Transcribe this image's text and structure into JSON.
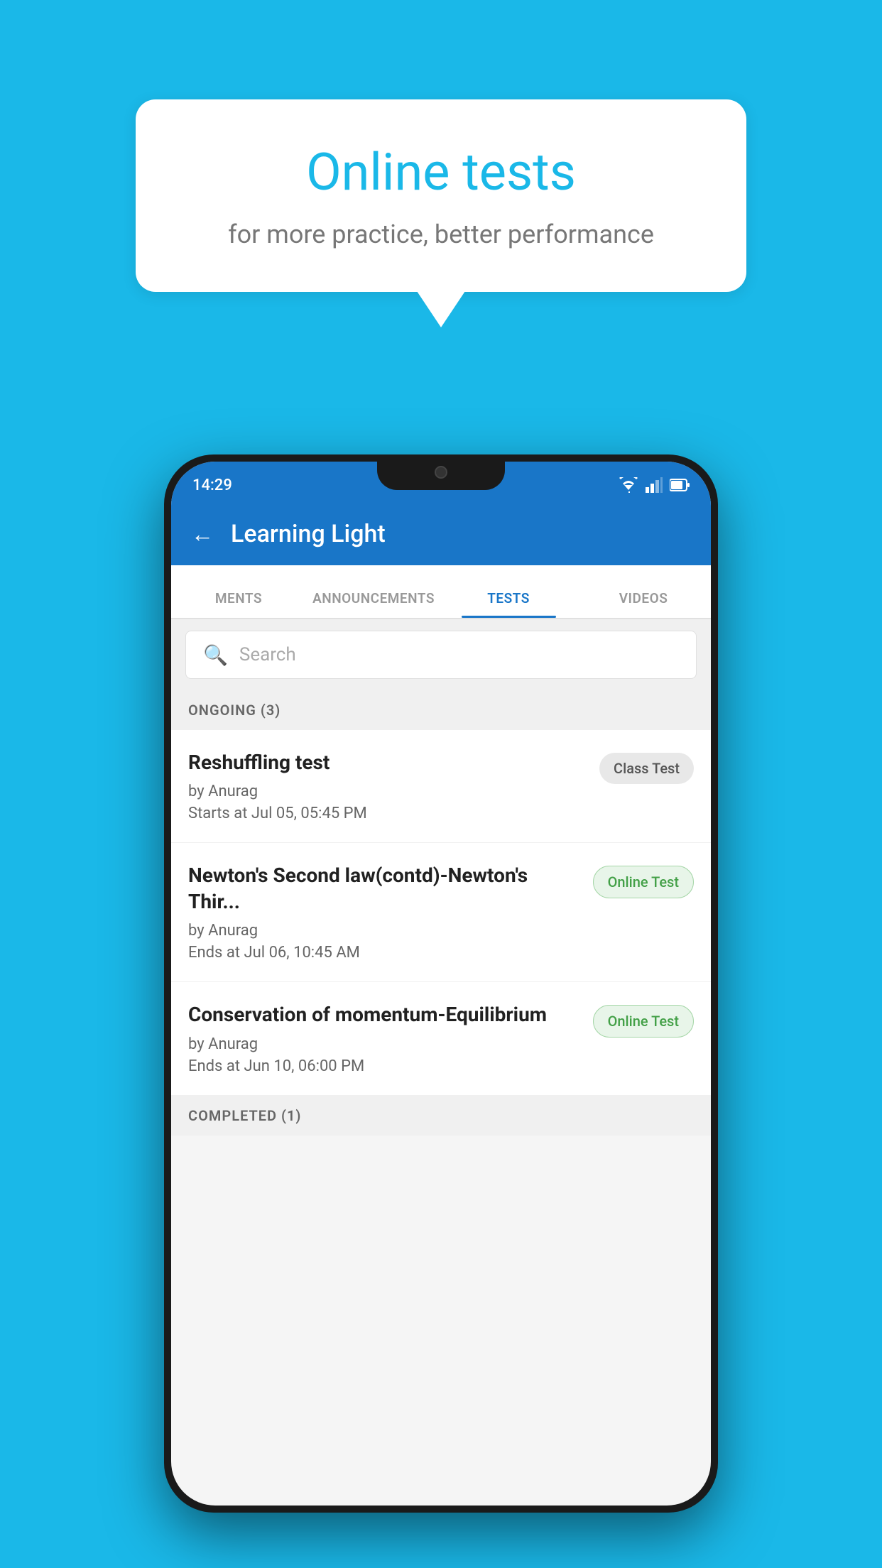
{
  "background_color": "#1ab8e8",
  "speech_bubble": {
    "title": "Online tests",
    "subtitle": "for more practice, better performance"
  },
  "phone": {
    "status_bar": {
      "time": "14:29"
    },
    "header": {
      "title": "Learning Light"
    },
    "tabs": [
      {
        "label": "MENTS",
        "active": false
      },
      {
        "label": "ANNOUNCEMENTS",
        "active": false
      },
      {
        "label": "TESTS",
        "active": true
      },
      {
        "label": "VIDEOS",
        "active": false
      }
    ],
    "search": {
      "placeholder": "Search"
    },
    "ongoing_section": {
      "label": "ONGOING (3)"
    },
    "tests": [
      {
        "title": "Reshuffling test",
        "author": "by Anurag",
        "date": "Starts at  Jul 05, 05:45 PM",
        "badge": "Class Test",
        "badge_type": "class"
      },
      {
        "title": "Newton's Second law(contd)-Newton's Thir...",
        "author": "by Anurag",
        "date": "Ends at  Jul 06, 10:45 AM",
        "badge": "Online Test",
        "badge_type": "online"
      },
      {
        "title": "Conservation of momentum-Equilibrium",
        "author": "by Anurag",
        "date": "Ends at  Jun 10, 06:00 PM",
        "badge": "Online Test",
        "badge_type": "online"
      }
    ],
    "completed_section": {
      "label": "COMPLETED (1)"
    }
  }
}
